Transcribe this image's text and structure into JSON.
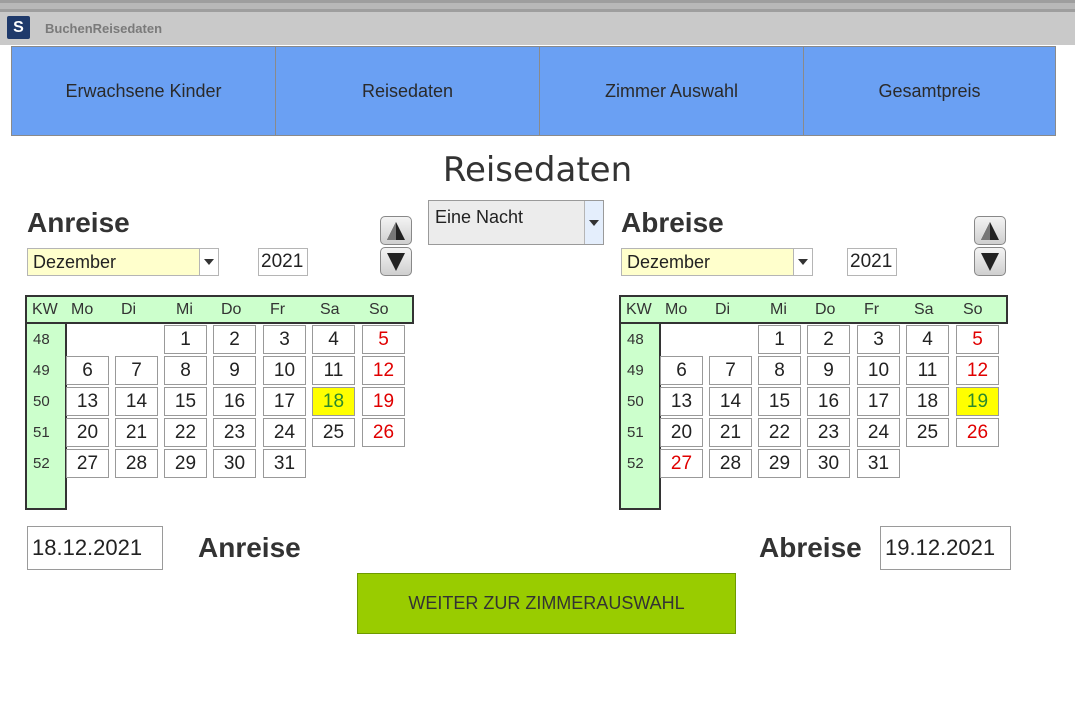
{
  "window": {
    "title": "BuchenReisedaten",
    "icon": "app-logo-icon",
    "icon_glyph": "S"
  },
  "tabs": [
    {
      "label": "Erwachsene Kinder"
    },
    {
      "label": "Reisedaten"
    },
    {
      "label": "Zimmer Auswahl"
    },
    {
      "label": "Gesamtpreis"
    }
  ],
  "page_title": "Reisedaten",
  "nights_select": {
    "value": "Eine Nacht"
  },
  "weekday_headers": [
    "KW",
    "Mo",
    "Di",
    "Mi",
    "Do",
    "Fr",
    "Sa",
    "So"
  ],
  "week_numbers": [
    "48",
    "49",
    "50",
    "51",
    "52"
  ],
  "arrival": {
    "label": "Anreise",
    "month": "Dezember",
    "year": "2021",
    "selected_day": "18",
    "date_value": "18.12.2021",
    "date_label": "Anreise",
    "red_days": [
      "5",
      "12",
      "19",
      "26"
    ]
  },
  "departure": {
    "label": "Abreise",
    "month": "Dezember",
    "year": "2021",
    "selected_day": "19",
    "date_value": "19.12.2021",
    "date_label": "Abreise",
    "red_days": [
      "5",
      "12",
      "26",
      "27"
    ]
  },
  "weeks": [
    [
      "",
      "",
      "1",
      "2",
      "3",
      "4",
      "5"
    ],
    [
      "6",
      "7",
      "8",
      "9",
      "10",
      "11",
      "12"
    ],
    [
      "13",
      "14",
      "15",
      "16",
      "17",
      "18",
      "19"
    ],
    [
      "20",
      "21",
      "22",
      "23",
      "24",
      "25",
      "26"
    ],
    [
      "27",
      "28",
      "29",
      "30",
      "31",
      "",
      ""
    ]
  ],
  "continue_button": "WEITER ZUR ZIMMERAUSWAHL",
  "colors": {
    "tab_bg": "#6aa0f3",
    "calendar_header_bg": "#ccffcc",
    "selected_day_bg": "#ffff00",
    "sunday_text": "#e00000",
    "month_select_bg": "#ffffcc",
    "continue_bg": "#99cc00"
  }
}
